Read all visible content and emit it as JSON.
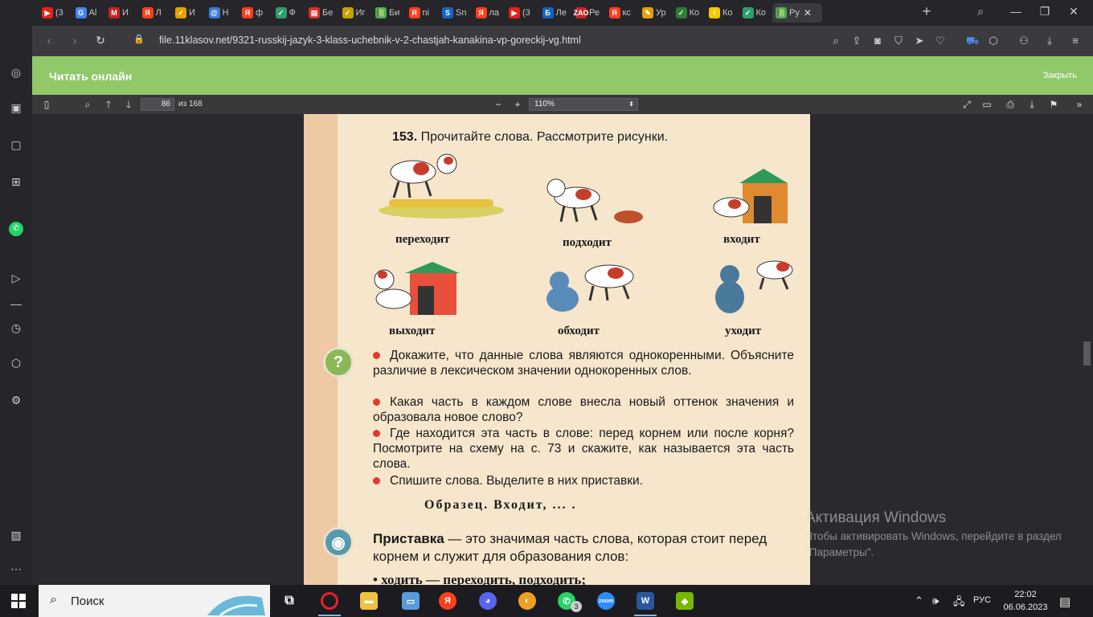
{
  "browser": {
    "tabs": [
      {
        "label": "(3",
        "color": "#e62117",
        "glyph": "▶"
      },
      {
        "label": "Al",
        "color": "#4285f4",
        "glyph": "G"
      },
      {
        "label": "И",
        "color": "#c5221f",
        "glyph": "M"
      },
      {
        "label": "Л",
        "color": "#fc3f1d",
        "glyph": "Я"
      },
      {
        "label": "И",
        "color": "#e5a100",
        "glyph": "✓"
      },
      {
        "label": "Н",
        "color": "#3a7bd5",
        "glyph": "@"
      },
      {
        "label": "ф",
        "color": "#fc3f1d",
        "glyph": "Я"
      },
      {
        "label": "Ф",
        "color": "#2f9e6f",
        "glyph": "✓"
      },
      {
        "label": "Бе",
        "color": "#d93025",
        "glyph": "▤"
      },
      {
        "label": "Иг",
        "color": "#c8a000",
        "glyph": "✓"
      },
      {
        "label": "Би",
        "color": "#4caf50",
        "glyph": "📗"
      },
      {
        "label": "ni",
        "color": "#fc3f1d",
        "glyph": "Я"
      },
      {
        "label": "Sn",
        "color": "#1565c0",
        "glyph": "S"
      },
      {
        "label": "ла",
        "color": "#fc3f1d",
        "glyph": "Я"
      },
      {
        "label": "(3",
        "color": "#e62117",
        "glyph": "▶"
      },
      {
        "label": "Ле",
        "color": "#1565c0",
        "glyph": "Б"
      },
      {
        "label": "Ре",
        "color": "#c62828",
        "glyph": "ZAO"
      },
      {
        "label": "кс",
        "color": "#fc3f1d",
        "glyph": "Я"
      },
      {
        "label": "Ур",
        "color": "#e5a100",
        "glyph": "✎"
      },
      {
        "label": "Ко",
        "color": "#2e7d32",
        "glyph": "✓"
      },
      {
        "label": "Ко",
        "color": "#f9c800",
        "glyph": "i"
      },
      {
        "label": "Ко",
        "color": "#2f9e6f",
        "glyph": "✓"
      },
      {
        "label": "Ру",
        "color": "#4caf50",
        "glyph": "📗"
      }
    ],
    "url": "file.11klasov.net/9321-russkij-jazyk-3-klass-uchebnik-v-2-chastjah-kanakina-vp-goreckij-vg.html"
  },
  "header": {
    "title": "Читать онлайн",
    "close_label": "Закрыть"
  },
  "pdf_toolbar": {
    "page_current": "86",
    "page_of": "из 168",
    "zoom": "110%"
  },
  "page": {
    "exercise_number": "153.",
    "exercise_text": "Прочитайте слова. Рассмотрите рисунки.",
    "words": [
      "переходит",
      "подходит",
      "входит",
      "выходит",
      "обходит",
      "уходит"
    ],
    "questions": [
      "Докажите, что данные слова являются однокоренными. Объясните различие в лексическом значении однокоренных слов.",
      "Какая часть в каждом слове внесла новый оттенок значения и образовала новое слово?",
      "Где находится эта часть в слове: перед корнем или после корня? Посмотрите на схему на с. 73 и скажите, как называется эта часть слова.",
      "Спишите слова. Выделите в них приставки."
    ],
    "obrazec": "Образец. Входит, ... .",
    "rule_term": "Приставка",
    "rule_text": " — это значимая часть слова, которая стоит перед корнем и служит для образования слов:",
    "rule_example": "• ходить — переходить, подходить;"
  },
  "watermark": {
    "line1": "Активация Windows",
    "line2": "Чтобы активировать Windows, перейдите в раздел \"Параметры\"."
  },
  "taskbar": {
    "search_label": "Поиск",
    "lang": "РУС",
    "time": "22:02",
    "date": "06.06.2023",
    "whatsapp_badge": "3"
  }
}
